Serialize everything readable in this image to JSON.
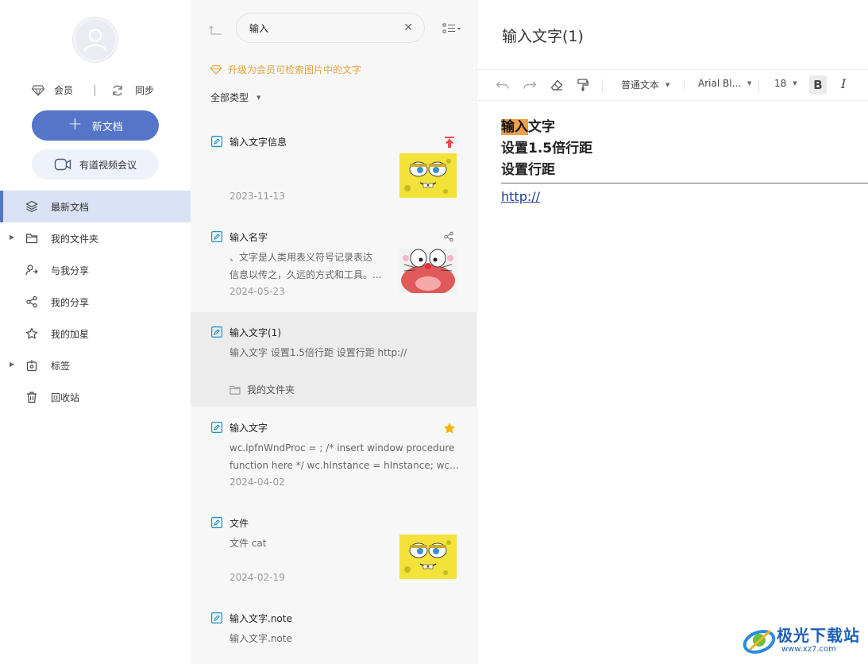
{
  "sidebar": {
    "member_label": "会员",
    "sync_label": "同步",
    "new_doc_label": "新文档",
    "meeting_label": "有道视频会议",
    "nav": [
      {
        "label": "最新文档",
        "icon": "layers-icon",
        "active": true
      },
      {
        "label": "我的文件夹",
        "icon": "folder-icon",
        "expandable": true
      },
      {
        "label": "与我分享",
        "icon": "users-share-icon"
      },
      {
        "label": "我的分享",
        "icon": "share-icon"
      },
      {
        "label": "我的加星",
        "icon": "star-outline-icon"
      },
      {
        "label": "标签",
        "icon": "tag-icon",
        "expandable": true
      },
      {
        "label": "回收站",
        "icon": "trash-icon"
      }
    ]
  },
  "list": {
    "search_value": "输入",
    "upgrade_tip": "升级为会员可检索图片中的文字",
    "filter_label": "全部类型",
    "items": [
      {
        "title": "输入文字信息",
        "excerpt": [],
        "date": "2023-11-13",
        "badge": "pin-top-icon",
        "thumb": "sponge-thumbnail"
      },
      {
        "title": "输入名字",
        "excerpt": [
          "、文字是人类用表义符号记录表达",
          "信息以传之，久远的方式和工具。..."
        ],
        "date": "2024-05-23",
        "badge": "share-icon",
        "thumb": "cat-thumbnail"
      },
      {
        "title": "输入文字(1)",
        "excerpt": [
          "输入文字 设置1.5倍行距 设置行距 http://"
        ],
        "folder": "我的文件夹",
        "selected": true
      },
      {
        "title": "输入文字",
        "excerpt": [
          "wc.lpfnWndProc = ; /* insert window procedure",
          "function here */ wc.hInstance = hInstance; wc.h..."
        ],
        "date": "2024-04-02",
        "badge": "star-icon"
      },
      {
        "title": "文件",
        "excerpt": [
          "文件 cat"
        ],
        "date": "2024-02-19",
        "thumb": "sponge-thumbnail"
      },
      {
        "title": "输入文字.note",
        "excerpt": [
          "输入文字.note"
        ]
      }
    ]
  },
  "editor": {
    "title": "输入文字(1)",
    "toolbar": {
      "paragraph_style": "普通文本",
      "font_family": "Arial Bl...",
      "font_size": "18",
      "bold": "B",
      "italic": "I"
    },
    "content": {
      "line1_highlight": "输入",
      "line1_rest": "文字",
      "line2": "设置1.5倍行距",
      "line3": "设置行距",
      "link": "http://"
    }
  },
  "watermark": {
    "name": "极光下载站",
    "url": "www.xz7.com"
  },
  "colors": {
    "accent": "#5475c8",
    "active_nav_bg": "#d9e2f5",
    "upgrade_text": "#e8a23b",
    "highlight": "#f0a04b",
    "pin_red": "#e84b4b",
    "star_yellow": "#f5b400"
  }
}
